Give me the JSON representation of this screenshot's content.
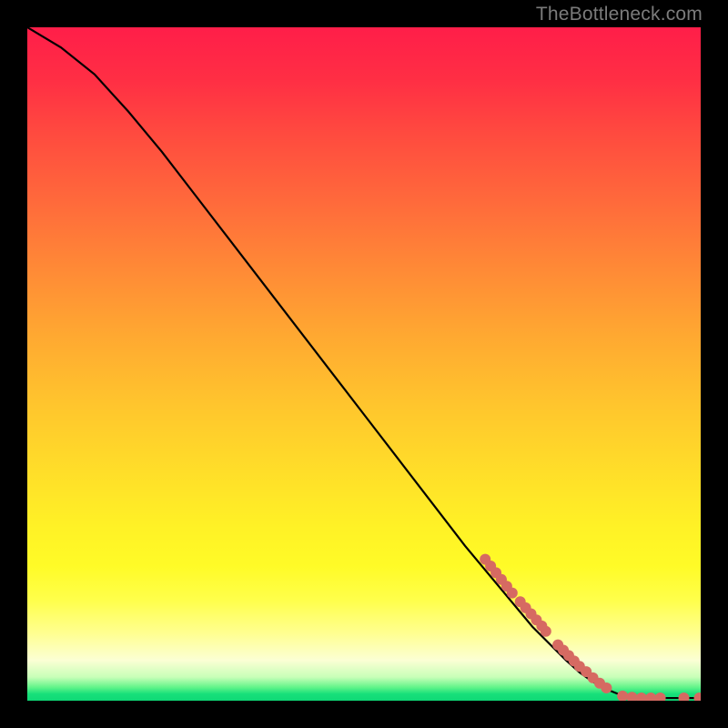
{
  "watermark": "TheBottleneck.com",
  "colors": {
    "background": "#000000",
    "line": "#000000",
    "marker": "#d66a62"
  },
  "chart_data": {
    "type": "line",
    "title": "",
    "xlabel": "",
    "ylabel": "",
    "xlim": [
      0,
      100
    ],
    "ylim": [
      0,
      100
    ],
    "grid": false,
    "legend": false,
    "series": [
      {
        "name": "curve",
        "x": [
          0,
          5,
          10,
          15,
          20,
          25,
          30,
          35,
          40,
          45,
          50,
          55,
          60,
          65,
          70,
          75,
          80,
          82,
          84,
          86,
          88,
          90,
          92,
          94,
          96,
          98,
          100
        ],
        "y": [
          100,
          97,
          93,
          87.5,
          81.5,
          75,
          68.5,
          62,
          55.5,
          49,
          42.5,
          36,
          29.5,
          23,
          17,
          11,
          6,
          4.2,
          2.8,
          1.7,
          0.9,
          0.5,
          0.4,
          0.4,
          0.4,
          0.4,
          0.4
        ]
      }
    ],
    "markers": [
      {
        "x": 68.0,
        "y": 21.0
      },
      {
        "x": 68.8,
        "y": 20.0
      },
      {
        "x": 69.6,
        "y": 19.0
      },
      {
        "x": 70.4,
        "y": 18.0
      },
      {
        "x": 71.2,
        "y": 17.0
      },
      {
        "x": 72.0,
        "y": 16.0
      },
      {
        "x": 73.2,
        "y": 14.7
      },
      {
        "x": 74.0,
        "y": 13.8
      },
      {
        "x": 74.8,
        "y": 12.9
      },
      {
        "x": 75.6,
        "y": 12.0
      },
      {
        "x": 76.4,
        "y": 11.1
      },
      {
        "x": 77.0,
        "y": 10.3
      },
      {
        "x": 78.8,
        "y": 8.3
      },
      {
        "x": 79.6,
        "y": 7.5
      },
      {
        "x": 80.4,
        "y": 6.7
      },
      {
        "x": 81.2,
        "y": 5.9
      },
      {
        "x": 82.0,
        "y": 5.1
      },
      {
        "x": 83.0,
        "y": 4.3
      },
      {
        "x": 84.0,
        "y": 3.4
      },
      {
        "x": 85.0,
        "y": 2.6
      },
      {
        "x": 86.0,
        "y": 1.9
      },
      {
        "x": 88.4,
        "y": 0.7
      },
      {
        "x": 89.8,
        "y": 0.5
      },
      {
        "x": 91.2,
        "y": 0.4
      },
      {
        "x": 92.6,
        "y": 0.4
      },
      {
        "x": 94.0,
        "y": 0.4
      },
      {
        "x": 97.5,
        "y": 0.4
      },
      {
        "x": 99.8,
        "y": 0.4
      }
    ]
  }
}
